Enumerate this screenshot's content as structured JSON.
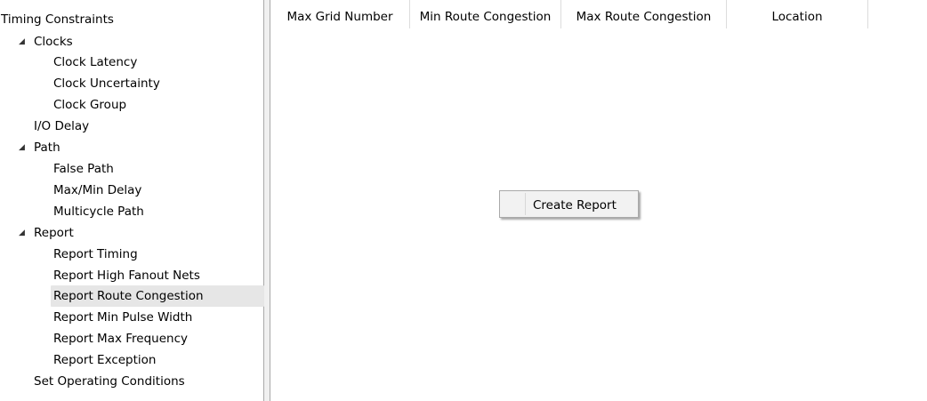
{
  "tree": {
    "items": [
      {
        "label": "Timing Constraints",
        "level": 0
      },
      {
        "label": "Clocks",
        "level": 1,
        "expanded": true
      },
      {
        "label": "Clock Latency",
        "level": 2
      },
      {
        "label": "Clock Uncertainty",
        "level": 2
      },
      {
        "label": "Clock Group",
        "level": 2
      },
      {
        "label": "I/O Delay",
        "level": 1
      },
      {
        "label": "Path",
        "level": 1,
        "expanded": true
      },
      {
        "label": "False Path",
        "level": 2
      },
      {
        "label": "Max/Min Delay",
        "level": 2
      },
      {
        "label": "Multicycle Path",
        "level": 2
      },
      {
        "label": "Report",
        "level": 1,
        "expanded": true
      },
      {
        "label": "Report Timing",
        "level": 2
      },
      {
        "label": "Report High Fanout Nets",
        "level": 2
      },
      {
        "label": "Report Route Congestion",
        "level": 2,
        "selected": true
      },
      {
        "label": "Report Min Pulse Width",
        "level": 2
      },
      {
        "label": "Report Max Frequency",
        "level": 2
      },
      {
        "label": "Report Exception",
        "level": 2
      },
      {
        "label": "Set Operating Conditions",
        "level": 1
      }
    ]
  },
  "grid": {
    "columns": [
      "Max Grid Number",
      "Min Route Congestion",
      "Max Route Congestion",
      "Location"
    ]
  },
  "context_menu": {
    "items": [
      {
        "label": "Create Report"
      }
    ]
  },
  "icons": {
    "expanded": "triangle-expanded-icon"
  },
  "colors": {
    "selection": "#e6e6e6",
    "border": "#a9a9a9",
    "menu_bg": "#f2f2f2"
  }
}
